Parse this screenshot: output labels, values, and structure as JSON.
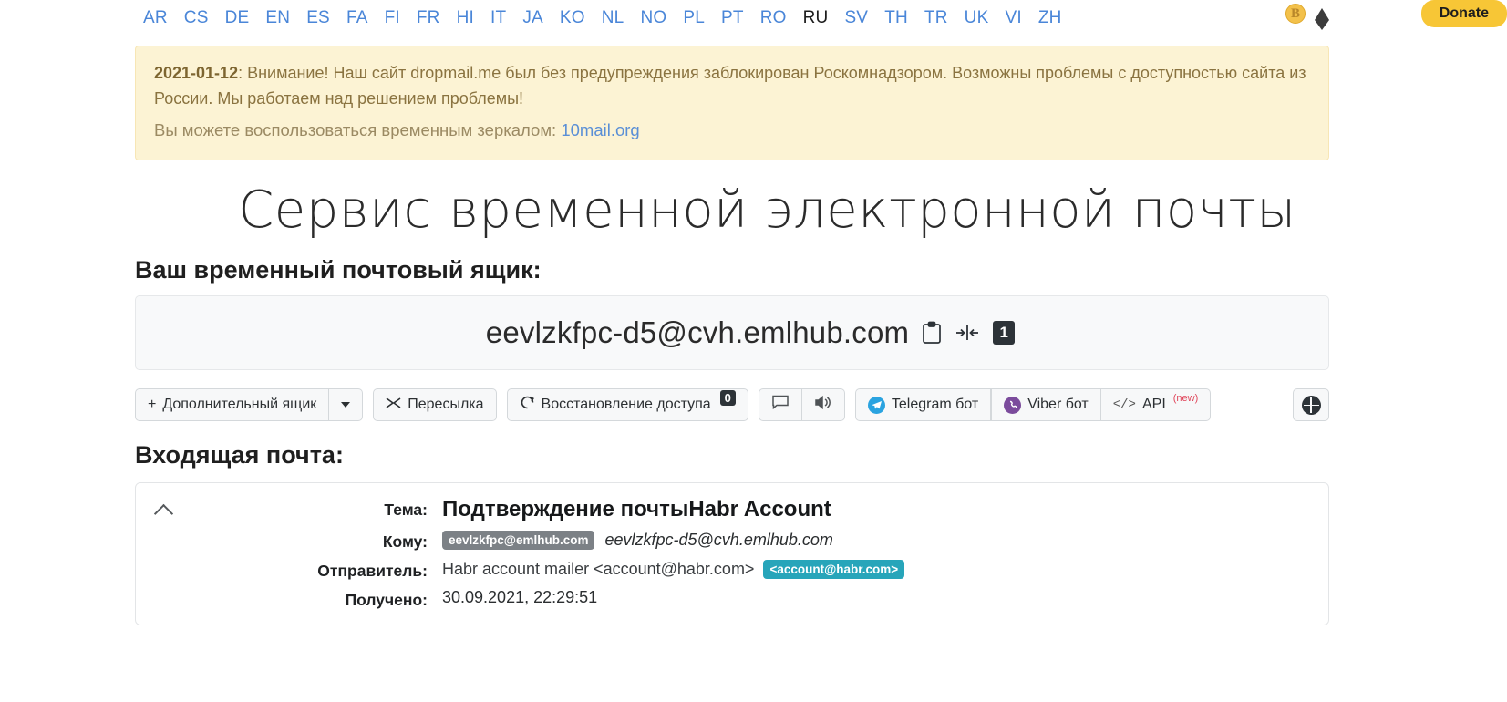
{
  "header": {
    "languages": [
      {
        "code": "AR",
        "active": false
      },
      {
        "code": "CS",
        "active": false
      },
      {
        "code": "DE",
        "active": false
      },
      {
        "code": "EN",
        "active": false
      },
      {
        "code": "ES",
        "active": false
      },
      {
        "code": "FA",
        "active": false
      },
      {
        "code": "FI",
        "active": false
      },
      {
        "code": "FR",
        "active": false
      },
      {
        "code": "HI",
        "active": false
      },
      {
        "code": "IT",
        "active": false
      },
      {
        "code": "JA",
        "active": false
      },
      {
        "code": "KO",
        "active": false
      },
      {
        "code": "NL",
        "active": false
      },
      {
        "code": "NO",
        "active": false
      },
      {
        "code": "PL",
        "active": false
      },
      {
        "code": "PT",
        "active": false
      },
      {
        "code": "RO",
        "active": false
      },
      {
        "code": "RU",
        "active": true
      },
      {
        "code": "SV",
        "active": false
      },
      {
        "code": "TH",
        "active": false
      },
      {
        "code": "TR",
        "active": false
      },
      {
        "code": "UK",
        "active": false
      },
      {
        "code": "VI",
        "active": false
      },
      {
        "code": "ZH",
        "active": false
      }
    ],
    "bitcoin_icon": "bitcoin-icon",
    "bitcoin_glyph": "B",
    "ethereum_icon": "ethereum-icon",
    "donate_label": "Donate",
    "donate_color": "#f7c636"
  },
  "alert": {
    "date": "2021-01-12",
    "text": ": Внимание! Наш сайт dropmail.me был без предупреждения заблокирован Роскомнадзором. Возможны проблемы с доступностью сайта из России. Мы работаем над решением проблемы!",
    "mirror_text": "Вы можете воспользоваться временным зеркалом: ",
    "mirror_link": "10mail.org",
    "bg_color": "#fcf3d4",
    "text_color": "#8a7340"
  },
  "page": {
    "title": "Сервис временной электронной почты",
    "mailbox_heading": "Ваш временный почтовый ящик:",
    "inbox_heading": "Входящая почта:"
  },
  "mailbox": {
    "address": "eevlzkfpc-d5@cvh.emlhub.com",
    "copy_icon": "clipboard-icon",
    "shorten_icon": "compress-arrows-icon",
    "count_badge": "1"
  },
  "toolbar": {
    "extra_mailbox_label": "Дополнительный ящик",
    "extra_mailbox_plus": "+",
    "dropdown_icon": "chevron-down-icon",
    "forward_label": "Пересылка",
    "forward_icon": "shuffle-icon",
    "restore_label": "Восстановление доступа",
    "restore_icon": "refresh-icon",
    "restore_badge": "0",
    "chat_icon": "chat-bubble-icon",
    "sound_icon": "speaker-icon",
    "telegram_label": "Telegram бот",
    "telegram_icon": "telegram-icon",
    "telegram_color": "#2aa3e0",
    "viber_label": "Viber бот",
    "viber_icon": "viber-icon",
    "viber_color": "#7b4b9c",
    "api_label": "API",
    "api_icon": "code-brackets-icon",
    "api_sup": "(new)",
    "api_sup_color": "#e0455a",
    "settings_icon": "globe-settings-icon"
  },
  "mail": {
    "collapse_icon": "chevron-up-icon",
    "labels": {
      "subject": "Тема:",
      "to": "Кому:",
      "sender": "Отправитель:",
      "received": "Получено:"
    },
    "subject": "Подтверждение почтыHabr Account",
    "to_chip": "eevlzkfpc@emlhub.com",
    "to_address": "eevlzkfpc-d5@cvh.emlhub.com",
    "sender_name": "Habr account mailer <account@habr.com>",
    "sender_chip": "<account@habr.com>",
    "received": "30.09.2021, 22:29:51"
  }
}
